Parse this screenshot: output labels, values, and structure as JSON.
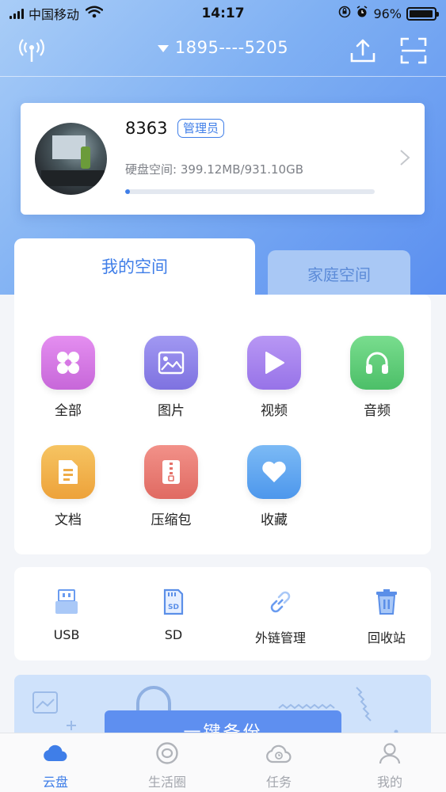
{
  "status_bar": {
    "carrier": "中国移动",
    "time": "14:17",
    "battery": "96%",
    "battery_level": 0.96
  },
  "header": {
    "account": "1895----5205"
  },
  "profile": {
    "name": "8363",
    "role": "管理员",
    "storage_label": "硬盘空间: 399.12MB/931.10GB",
    "usage_fraction": 0.0004
  },
  "space_tabs": [
    {
      "label": "我的空间",
      "active": true
    },
    {
      "label": "家庭空间",
      "active": false
    }
  ],
  "categories": [
    {
      "label": "全部",
      "icon": "grid-icon",
      "color": "#d977e0"
    },
    {
      "label": "图片",
      "icon": "image-icon",
      "color": "#8e84ea"
    },
    {
      "label": "视频",
      "icon": "play-icon",
      "color": "#a583ee"
    },
    {
      "label": "音频",
      "icon": "headphones-icon",
      "color": "#5fcd7a"
    },
    {
      "label": "文档",
      "icon": "document-icon",
      "color": "#f0b24a"
    },
    {
      "label": "压缩包",
      "icon": "zip-icon",
      "color": "#ea7c74"
    },
    {
      "label": "收藏",
      "icon": "heart-icon",
      "color": "#5da8f2"
    }
  ],
  "tools": [
    {
      "label": "USB",
      "icon": "usb-icon"
    },
    {
      "label": "SD",
      "icon": "sd-card-icon"
    },
    {
      "label": "外链管理",
      "icon": "link-icon"
    },
    {
      "label": "回收站",
      "icon": "trash-icon"
    }
  ],
  "banner": {
    "button_label": "一键备份"
  },
  "tabbar": [
    {
      "label": "云盘",
      "icon": "cloud-icon",
      "active": true
    },
    {
      "label": "生活圈",
      "icon": "circle-icon",
      "active": false
    },
    {
      "label": "任务",
      "icon": "task-cloud-icon",
      "active": false
    },
    {
      "label": "我的",
      "icon": "user-icon",
      "active": false
    }
  ],
  "colors": {
    "accent": "#3f7ee8",
    "header_gradient_start": "#a9cdf7",
    "header_gradient_end": "#5b8ff0"
  }
}
